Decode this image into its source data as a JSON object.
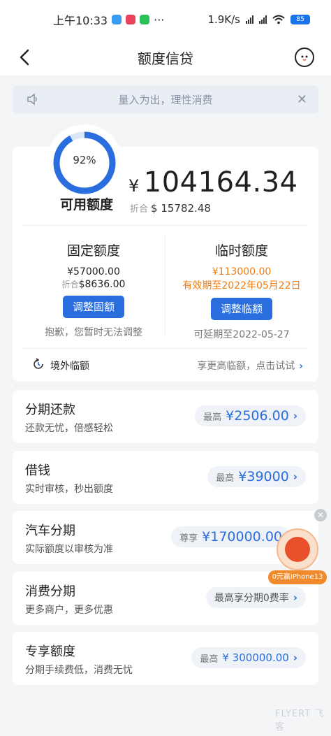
{
  "status_bar": {
    "time": "上午10:33",
    "dots": "···",
    "net_speed": "1.9K/s",
    "battery": "85"
  },
  "header": {
    "title": "额度信贷"
  },
  "notice": {
    "text": "量入为出，理性消费",
    "close": "✕"
  },
  "credit": {
    "percent": "92%",
    "percent_value": 0.92,
    "available_label": "可用额度",
    "currency": "¥",
    "amount": "104164.34",
    "fold_label": "折合",
    "fold_value": "$ 15782.48"
  },
  "fixed": {
    "title": "固定额度",
    "amount": "¥57000.00",
    "fold_label": "折合",
    "fold_value": "$8636.00",
    "button": "调整固额",
    "note": "抱歉，您暂时无法调整"
  },
  "temp": {
    "title": "临时额度",
    "amount": "¥113000.00",
    "validity": "有效期至2022年05月22日",
    "button": "调整临额",
    "note": "可延期至2022-05-27"
  },
  "overseas": {
    "label": "境外临额",
    "hint": "享更高临额，点击试试"
  },
  "products": [
    {
      "title": "分期还款",
      "subtitle": "还款无忧，倍感轻松",
      "prefix": "最高",
      "value": "¥2506.00"
    },
    {
      "title": "借钱",
      "subtitle": "实时审核，秒出额度",
      "prefix": "最高",
      "value": "¥39000"
    },
    {
      "title": "汽车分期",
      "subtitle": "实际额度以审核为准",
      "prefix": "尊享",
      "value": "¥170000.00"
    },
    {
      "title": "消费分期",
      "subtitle": "更多商户，更多优惠",
      "text": "最高享分期0费率"
    },
    {
      "title": "专享额度",
      "subtitle": "分期手续费低，消费无忧",
      "prefix": "最高",
      "value": "¥ 300000.00"
    }
  ],
  "promo": {
    "label": "0元赢iPhone13"
  },
  "watermark": "FLYERT 飞客",
  "colors": {
    "primary_blue": "#2a6ddf",
    "orange": "#ef7d12",
    "ring_track": "#dbe6f8"
  }
}
